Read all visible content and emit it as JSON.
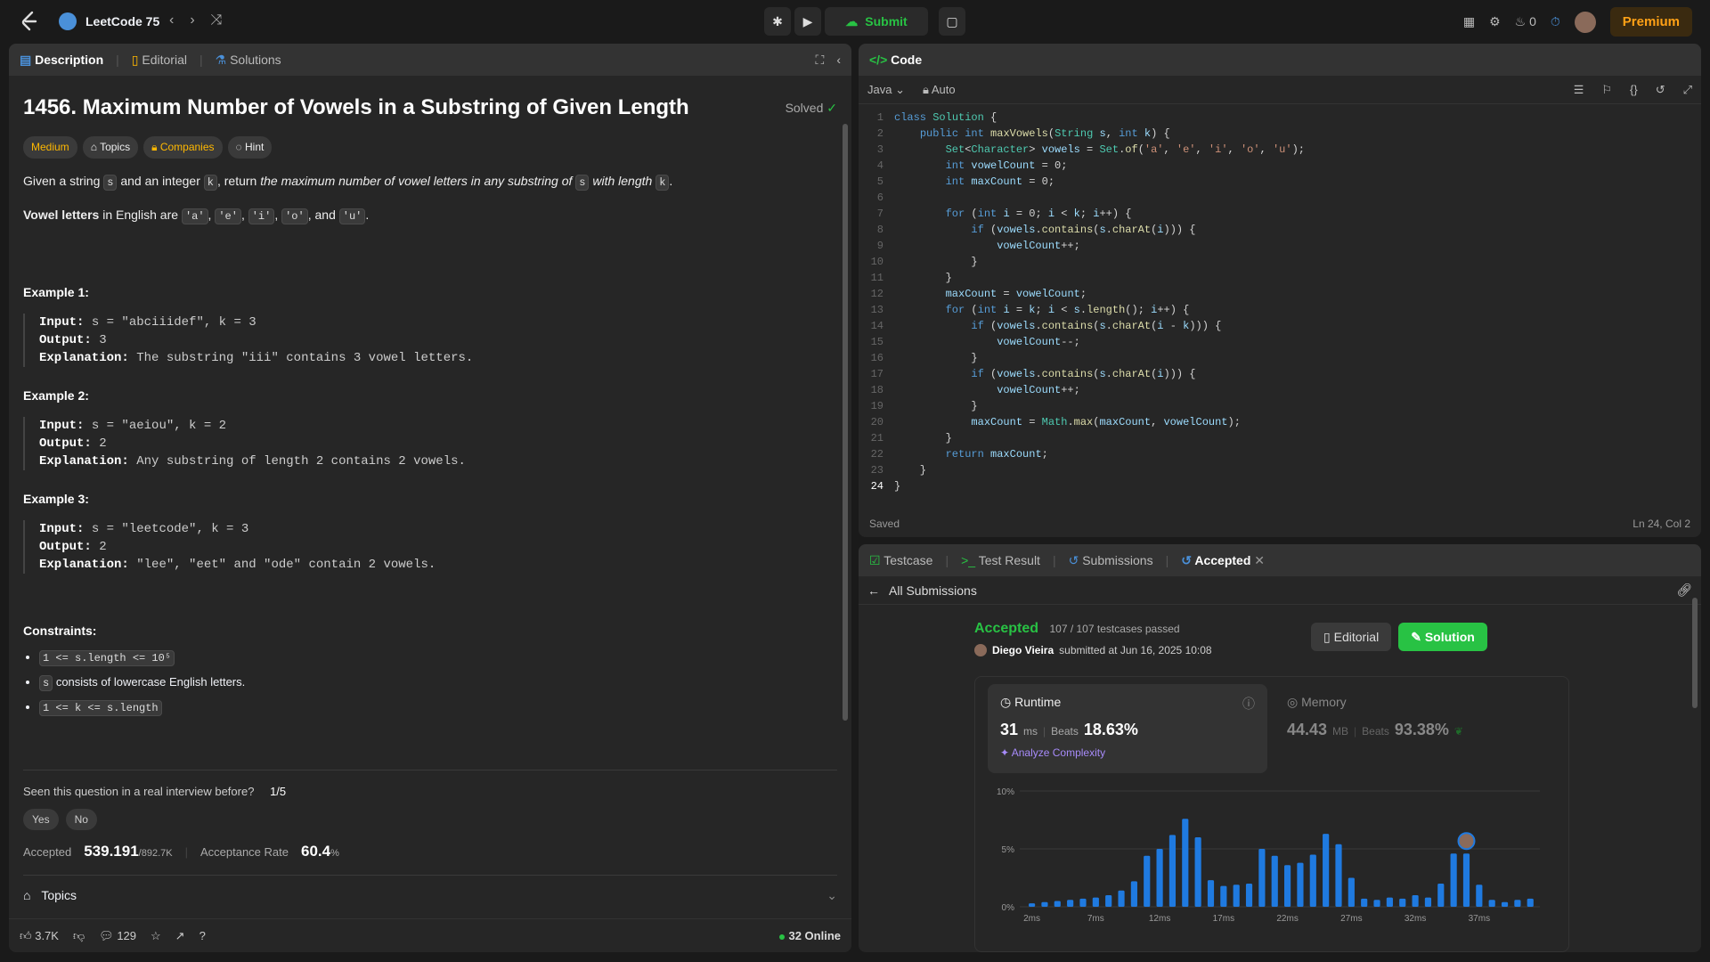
{
  "topbar": {
    "list_name": "LeetCode 75",
    "submit_label": "Submit",
    "streak": "0",
    "premium_label": "Premium"
  },
  "left_tabs": [
    "Description",
    "Editorial",
    "Solutions"
  ],
  "problem": {
    "title": "1456. Maximum Number of Vowels in a Substring of Given Length",
    "status": "Solved",
    "difficulty": "Medium",
    "tags": [
      "Topics",
      "Companies",
      "Hint"
    ],
    "stmt_1": "Given a string",
    "stmt_s": "s",
    "stmt_2": "and an integer",
    "stmt_k": "k",
    "stmt_3": ", return",
    "stmt_em": "the maximum number of vowel letters in any substring of",
    "stmt_s2": "s",
    "stmt_em2": "with length",
    "stmt_k2": "k",
    "stmt_end": ".",
    "vowel_bold": "Vowel letters",
    "vowel_text": "in English are",
    "vowels": [
      "'a'",
      "'e'",
      "'i'",
      "'o'",
      "'u'"
    ],
    "vowel_and": "and",
    "examples": [
      {
        "heading": "Example 1:",
        "input": "s = \"abciiidef\", k = 3",
        "output": "3",
        "explanation": "The substring \"iii\" contains 3 vowel letters."
      },
      {
        "heading": "Example 2:",
        "input": "s = \"aeiou\", k = 2",
        "output": "2",
        "explanation": "Any substring of length 2 contains 2 vowels."
      },
      {
        "heading": "Example 3:",
        "input": "s = \"leetcode\", k = 3",
        "output": "2",
        "explanation": "\"lee\", \"eet\" and \"ode\" contain 2 vowels."
      }
    ],
    "labels": {
      "input": "Input:",
      "output": "Output:",
      "explanation": "Explanation:"
    },
    "constraints_heading": "Constraints:",
    "constraints": [
      "1 <= s.length <= 10⁵",
      "consists of lowercase English letters.",
      "1 <= k <= s.length"
    ],
    "constraint_s": "s"
  },
  "interview": {
    "question": "Seen this question in a real interview before?",
    "count": "1/5",
    "yes": "Yes",
    "no": "No"
  },
  "stats": {
    "accepted_label": "Accepted",
    "accepted": "539.191",
    "submissions": "/892.7K",
    "rate_label": "Acceptance Rate",
    "rate": "60.4",
    "rate_unit": "%"
  },
  "topics_label": "Topics",
  "footer": {
    "likes": "3.7K",
    "comments": "129",
    "online": "32 Online"
  },
  "code_panel": {
    "title": "Code",
    "language": "Java",
    "mode": "Auto",
    "saved": "Saved",
    "cursor": "Ln 24, Col 2"
  },
  "result_tabs": [
    "Testcase",
    "Test Result",
    "Submissions",
    "Accepted"
  ],
  "result": {
    "back_label": "All Submissions",
    "status": "Accepted",
    "passed": "107 / 107 testcases passed",
    "user": "Diego Vieira",
    "submitted": "submitted at Jun 16, 2025 10:08",
    "editorial_label": "Editorial",
    "solution_label": "Solution",
    "runtime_label": "Runtime",
    "runtime": "31",
    "runtime_unit": "ms",
    "beats_label": "Beats",
    "runtime_beats": "18.63%",
    "analyze_label": "Analyze Complexity",
    "memory_label": "Memory",
    "memory": "44.43",
    "memory_unit": "MB",
    "memory_beats": "93.38%"
  },
  "chart_data": {
    "type": "bar",
    "yticks": [
      "10%",
      "5%",
      "0%"
    ],
    "xticks": [
      "2ms",
      "7ms",
      "12ms",
      "17ms",
      "22ms",
      "27ms",
      "32ms",
      "37ms"
    ],
    "ylim": [
      0,
      10
    ],
    "values": [
      0.3,
      0.4,
      0.5,
      0.6,
      0.7,
      0.8,
      1.0,
      1.4,
      2.2,
      4.4,
      5.0,
      6.2,
      7.6,
      6.0,
      2.3,
      1.8,
      1.9,
      2.0,
      5.0,
      4.4,
      3.6,
      3.8,
      4.5,
      6.3,
      5.4,
      2.5,
      0.7,
      0.6,
      0.8,
      0.7,
      1.0,
      0.8,
      2.0,
      4.6,
      4.6,
      1.9,
      0.6,
      0.4,
      0.6,
      0.7
    ],
    "user_bar_index": 34
  }
}
